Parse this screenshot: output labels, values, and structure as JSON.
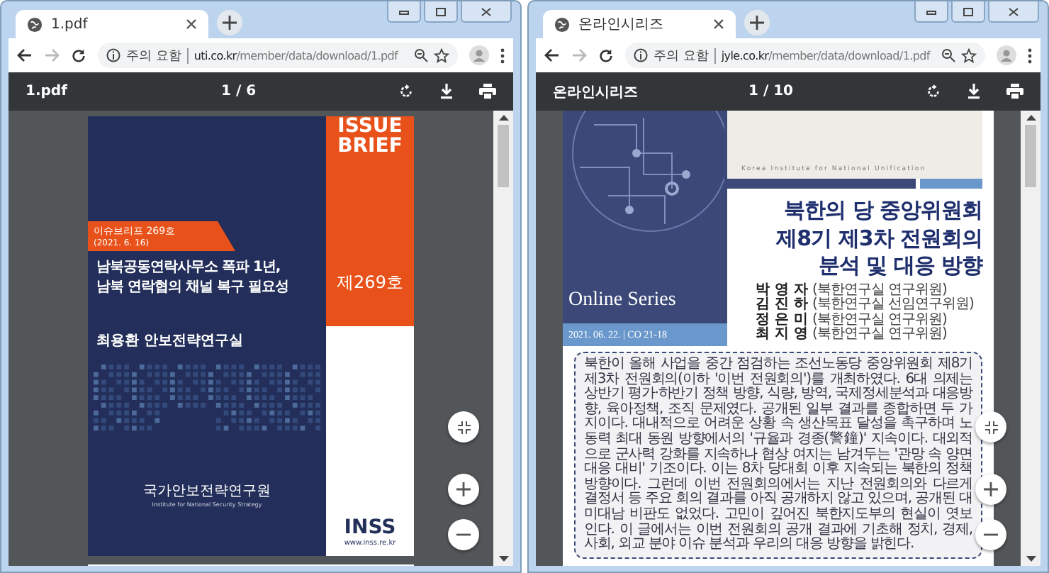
{
  "windows": [
    {
      "tab": {
        "title": "1.pdf"
      },
      "address": {
        "security": "주의 요함",
        "host": "uti.co.kr",
        "path": "/member/data/download/1.pdf"
      },
      "pdf_toolbar": {
        "title": "1.pdf",
        "page": "1 / 6"
      },
      "page": {
        "kind": "brief",
        "brief_label": [
          "ISSUE",
          "BRIEF"
        ],
        "series_tag": "이슈브리프 269호",
        "date": "(2021. 6. 16)",
        "title_lines": [
          "남북공동연락사무소 폭파 1년,",
          "남북 연락협의 채널 복구 필요성"
        ],
        "author": "최용환 안보전략연구실",
        "issue_no": "제269호",
        "publisher": "국가안보전략연구원",
        "publisher_en": "Institute for National Security Strategy",
        "logo": "INSS",
        "website": "www.inss.re.kr"
      }
    },
    {
      "tab": {
        "title": "온라인시리즈"
      },
      "address": {
        "security": "주의 요함",
        "host": "jyle.co.kr",
        "path": "/member/data/download/1.pdf"
      },
      "pdf_toolbar": {
        "title": "온라인시리즈",
        "page": "1 / 10"
      },
      "page": {
        "kind": "series",
        "institute": "Korea Institute for National Unification",
        "series_name": "Online Series",
        "date_code": "2021. 06. 22. | CO 21-18",
        "title_lines": [
          "북한의 당 중앙위원회",
          "제8기 제3차 전원회의",
          "분석 및 대응 방향"
        ],
        "authors": [
          {
            "name": "박 영 자",
            "role": "(북한연구실 연구위원)"
          },
          {
            "name": "김 진 하",
            "role": "(북한연구실 선임연구위원)"
          },
          {
            "name": "정 은 미",
            "role": "(북한연구실 연구위원)"
          },
          {
            "name": "최 지 영",
            "role": "(북한연구실 연구위원)"
          }
        ],
        "abstract": "북한이 올해 사업을 중간 점검하는 조선노동당 중앙위원회 제8기 제3차 전원회의(이하 '이번 전원회의')를 개최하였다. 6대 의제는 상반기 평가·하반기 정책 방향, 식량, 방역, 국제정세분석과 대응방향, 육아정책, 조직 문제였다. 공개된 일부 결과를 종합하면 두 가지이다. 대내적으로 어려운 상황 속 생산목표 달성을 촉구하며 노동력 최대 동원 방향에서의 '규율과 경종(警鐘)' 지속이다. 대외적으로 군사력 강화를 지속하나 협상 여지는 남겨두는 '관망 속 양면 대응 대비' 기조이다. 이는 8차 당대회 이후 지속되는 북한의 정책 방향이다. 그런데 이번 전원회의에서는 지난 전원회의와 다르게 결정서 등 주요 회의 결과를 아직 공개하지 않고 있으며, 공개된 대미대남 비판도 없었다. 고민이 깊어진 북한지도부의 현실이 엿보인다. 이 글에서는 이번 전원회의 공개 결과에 기초해 정치, 경제, 사회, 외교 분야 이슈 분석과 우리의 대응 방향을 밝힌다."
      }
    }
  ]
}
